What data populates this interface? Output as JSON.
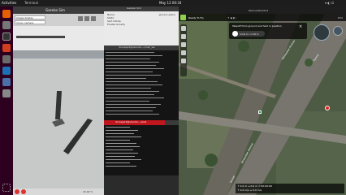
{
  "topbar": {
    "left": "Activities",
    "app": "Terminal",
    "clock": "May 12  00:34",
    "right": "?"
  },
  "dock": {
    "items": [
      "firefox-icon",
      "files-icon",
      "terminal-icon",
      "gazebo-icon",
      "settings-icon",
      "vscode-icon",
      "help-icon",
      "trash-icon",
      "apps-icon"
    ]
  },
  "gazebo": {
    "window_title": "Gazebo Sim",
    "panel_header": "Image display",
    "camera_select": "mono_camera",
    "bottom_status": "23.00 %"
  },
  "rviz": {
    "title": "Gazebo Sim",
    "rows": [
      {
        "label": "Name",
        "value": "ground_plane"
      },
      {
        "label": "Static",
        "value": ""
      },
      {
        "label": "Self Collide",
        "value": ""
      },
      {
        "label": "Enable Gravity",
        "value": ""
      }
    ]
  },
  "terminals": {
    "t1_title": "dronepx4@ubuntu:~/ros2_ws",
    "t2_title": "dronepx4@ubuntu:~/px4",
    "t3_title": "dronepx4@ubuntu:~/ros2_ws"
  },
  "qgc": {
    "title": "QGroundControl",
    "mode": "Ready To Fly",
    "tooltip": "Takeoff from ground and hold in position",
    "slider_label": "Slide to confirm",
    "road_labels": [
      "Milwaukee Avenue",
      "Tunnel",
      "Milwaukee Avenue",
      "Tunnel"
    ],
    "telemetry": "↑ 0.0 m   ↔ 0.0 m   ⏱ 00:00:00",
    "telemetry2": "↑ 0.0 m/s   ↔ 0.0 m/s"
  }
}
